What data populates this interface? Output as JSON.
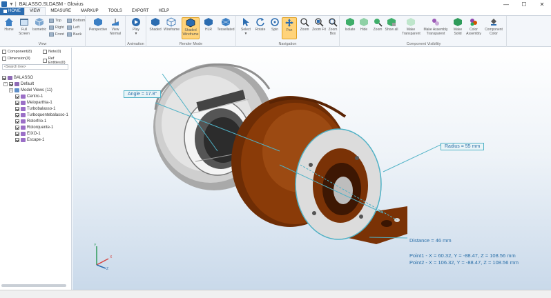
{
  "window": {
    "title": "BALASSO.SLDASM - Glovius",
    "sep": "▼ |",
    "minimize": "—",
    "maximize": "☐",
    "close": "✕"
  },
  "menu": {
    "tabs": [
      "HOME",
      "VIEW",
      "MEASURE",
      "MARKUP",
      "TOOLS",
      "EXPORT",
      "HELP"
    ],
    "active": "VIEW"
  },
  "ribbon": {
    "view_group": {
      "label": "View",
      "home": "Home",
      "full_screen": "Full Screen",
      "isometric": "Isometric",
      "top": "Top",
      "right": "Right",
      "front": "Front",
      "bottom": "Bottom",
      "left": "Left",
      "back": "Back",
      "perspective": "Perspective",
      "view_normal": "View Normal"
    },
    "animation_group": {
      "label": "Animation",
      "play": "Play"
    },
    "render_group": {
      "label": "Render Mode",
      "shaded": "Shaded",
      "wireframe": "Wireframe",
      "shaded_wireframe": "Shaded Wireframe",
      "hlr": "HLR",
      "tessellated": "Tessellated"
    },
    "navigation_group": {
      "label": "Navigation",
      "select": "Select",
      "rotate": "Rotate",
      "spin": "Spin",
      "pan": "Pan",
      "zoom": "Zoom",
      "zoom_fit": "Zoom Fit",
      "zoom_box": "Zoom Box"
    },
    "visibility_group": {
      "label": "Component Visibility",
      "isolate": "Isolate",
      "hide": "Hide",
      "zoom": "Zoom",
      "show_all": "Show all",
      "make_transparent": "Make Transparent",
      "make_assembly_transparent": "Make Assembly Transparent",
      "make_solid": "Make Solid",
      "color_assembly": "Color Assembly",
      "component_color": "Component Color"
    }
  },
  "left_panel": {
    "filters": {
      "components": "Component(8)",
      "dimension": "Dimension(0)",
      "note": "Note(0)",
      "ref_entities": "Ref Entities(0)"
    },
    "search_placeholder": "<Search tree>",
    "tree": {
      "root": "BALASSO",
      "config": "Default",
      "model_views": "Model Views (11)",
      "items": [
        "Centro-1",
        "Meioparthia-1",
        "Turbobalasso-1",
        "Turboquentebalasso-1",
        "Rotorfrio-1",
        "Rotorquente-1",
        "EIXO-1",
        "Escape-1"
      ]
    }
  },
  "viewport": {
    "angle_label": "Angle = 17.8°",
    "radius_label": "Radius = 55 mm",
    "distance_label": "Distance = 46 mm",
    "point1": "Point1 - X = 60.32, Y = -88.47, Z = 108.56 mm",
    "point2": "Point2 - X = 106.32, Y = -88.47, Z = 108.56 mm",
    "triad": {
      "x": "X",
      "y": "Y",
      "z": "Z"
    }
  },
  "colors": {
    "accent": "#2b6cb0",
    "measure": "#4fb2c6",
    "turbine_body": "#8a3b08",
    "compressor_body": "#b8b8b8",
    "active_tool": "#ffd37a"
  }
}
